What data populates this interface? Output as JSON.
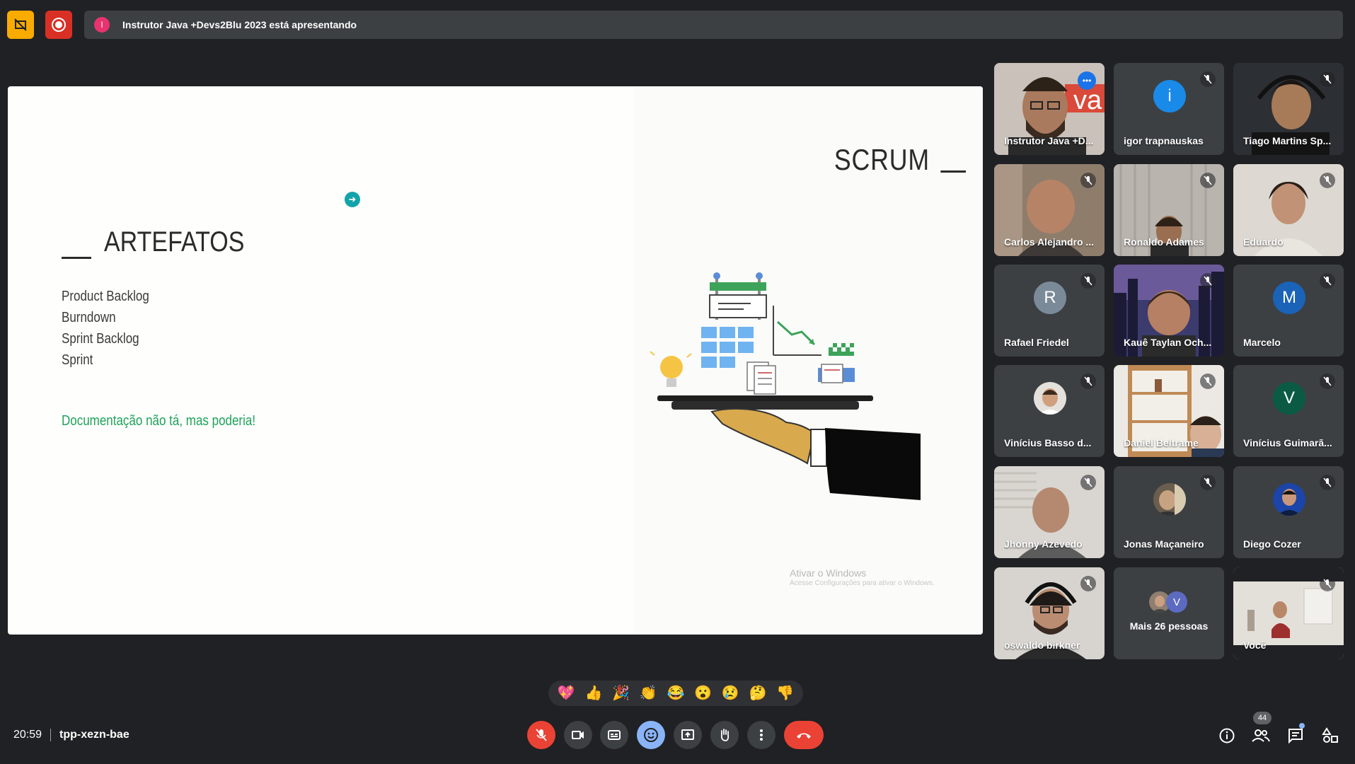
{
  "top": {
    "presenting_initial": "I",
    "presenting_text": "Instrutor Java +Devs2Blu 2023 está apresentando"
  },
  "slide": {
    "scrum_title": "SCRUM",
    "artefatos_title": "ARTEFATOS",
    "artefatos_items": [
      "Product Backlog",
      "Burndown",
      "Sprint Backlog",
      "Sprint"
    ],
    "note": "Documentação não tá, mas poderia!",
    "watermark_title": "Ativar o Windows",
    "watermark_sub": "Acesse Configurações para ativar o Windows."
  },
  "participants": [
    {
      "name": "Instrutor Java +D...",
      "status": "speaking"
    },
    {
      "name": "igor trapnauskas",
      "initial": "i",
      "avatar_color": "#1a8ae8",
      "status": "muted"
    },
    {
      "name": "Tiago Martins Sp...",
      "status": "muted"
    },
    {
      "name": "Carlos Alejandro ...",
      "status": "muted"
    },
    {
      "name": "Ronaldo Adames",
      "status": "muted"
    },
    {
      "name": "Eduardo",
      "status": "muted"
    },
    {
      "name": "Rafael Friedel",
      "initial": "R",
      "avatar_color": "#7b8a99",
      "status": "muted"
    },
    {
      "name": "Kauê Taylan Och...",
      "status": "muted"
    },
    {
      "name": "Marcelo",
      "initial": "M",
      "avatar_color": "#1a63b8",
      "status": "muted"
    },
    {
      "name": "Vinícius Basso d...",
      "status": "muted"
    },
    {
      "name": "Daniel Beltrame",
      "status": "muted"
    },
    {
      "name": "Vinícius Guimarã...",
      "initial": "V",
      "avatar_color": "#0b5b44",
      "status": "muted"
    },
    {
      "name": "Jhonny Azevedo",
      "status": "muted"
    },
    {
      "name": "Jonas Maçaneiro",
      "status": "muted"
    },
    {
      "name": "Diego Cozer",
      "status": "muted"
    },
    {
      "name": "oswaldo birkner",
      "status": "muted"
    },
    {
      "name": "Mais 26 pessoas",
      "initial": "V"
    },
    {
      "name": "Você",
      "status": "muted"
    }
  ],
  "reactions": [
    "💖",
    "👍",
    "🎉",
    "👏",
    "😂",
    "😮",
    "😢",
    "🤔",
    "👎"
  ],
  "bottom": {
    "time": "20:59",
    "meeting_code": "tpp-xezn-bae",
    "people_count": "44"
  }
}
